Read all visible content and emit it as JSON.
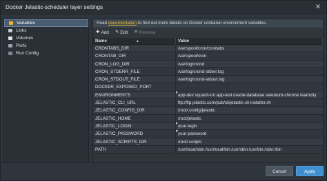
{
  "window": {
    "title": "Docker Jelastic-scheduler layer settings",
    "close_glyph": "✕"
  },
  "sidebar": {
    "items": [
      {
        "label": "Variables",
        "icon": "variables-icon",
        "color": "#f0b429",
        "active": true
      },
      {
        "label": "Links",
        "icon": "links-icon",
        "color": "#c6cbd1",
        "active": false
      },
      {
        "label": "Volumes",
        "icon": "volumes-icon",
        "color": "#dfe3e7",
        "active": false
      },
      {
        "label": "Ports",
        "icon": "ports-icon",
        "color": "#9aa3ad",
        "active": false
      },
      {
        "label": "Run Config",
        "icon": "run-config-icon",
        "color": "#7f8a96",
        "active": false
      }
    ]
  },
  "info": {
    "prefix": "Read ",
    "link": "documentation",
    "suffix": " to find out more details on Docker container environment variables."
  },
  "toolbar": {
    "add_icon": "✚",
    "add_label": "Add",
    "edit_icon": "✎",
    "edit_label": "Edit",
    "remove_icon": "✖",
    "remove_label": "Remove"
  },
  "grid": {
    "columns": [
      "Name",
      "Value"
    ],
    "rows": [
      {
        "name": "CRONTABS_DIR",
        "value": "/var/spool/cron/crontabs",
        "edited": false
      },
      {
        "name": "CRONTAB_DIR",
        "value": "/var/spool/cron",
        "edited": false
      },
      {
        "name": "CRON_LOG_DIR",
        "value": "/var/log/crond",
        "edited": false
      },
      {
        "name": "CRON_STDERR_FILE",
        "value": "/var/log/crond-stderr.log",
        "edited": false
      },
      {
        "name": "CRON_STDOUT_FILE",
        "value": "/var/log/crond-stdout.log",
        "edited": false
      },
      {
        "name": "DOCKER_EXPOSED_PORT",
        "value": "",
        "edited": false
      },
      {
        "name": "ENVIRONMENTS",
        "value": "app-dev squash-tm app-test oracle-database selenium-chrome teamcity",
        "edited": true
      },
      {
        "name": "JELASTIC_CLI_URL",
        "value": "ftp://ftp.jelastic.com/pub/cli/jelastic-cli-installer.sh",
        "edited": false
      },
      {
        "name": "JELASTIC_CONFIG_DIR",
        "value": "/root/.config/jelastic",
        "edited": false
      },
      {
        "name": "JELASTIC_HOME",
        "value": "/root/jelastic",
        "edited": false
      },
      {
        "name": "JELASTIC_LOGIN",
        "value": "your-login",
        "edited": true
      },
      {
        "name": "JELASTIC_PASSWORD",
        "value": "your-password",
        "edited": true
      },
      {
        "name": "JELASTIC_SCRIPTS_DIR",
        "value": "/root/.scripts",
        "edited": false
      },
      {
        "name": "PATH",
        "value": "/usr/local/sbin:/usr/local/bin:/usr/sbin:/usr/bin:/sbin:/bin",
        "edited": false
      }
    ]
  },
  "buttons": {
    "cancel": "Cancel",
    "apply": "Apply"
  }
}
